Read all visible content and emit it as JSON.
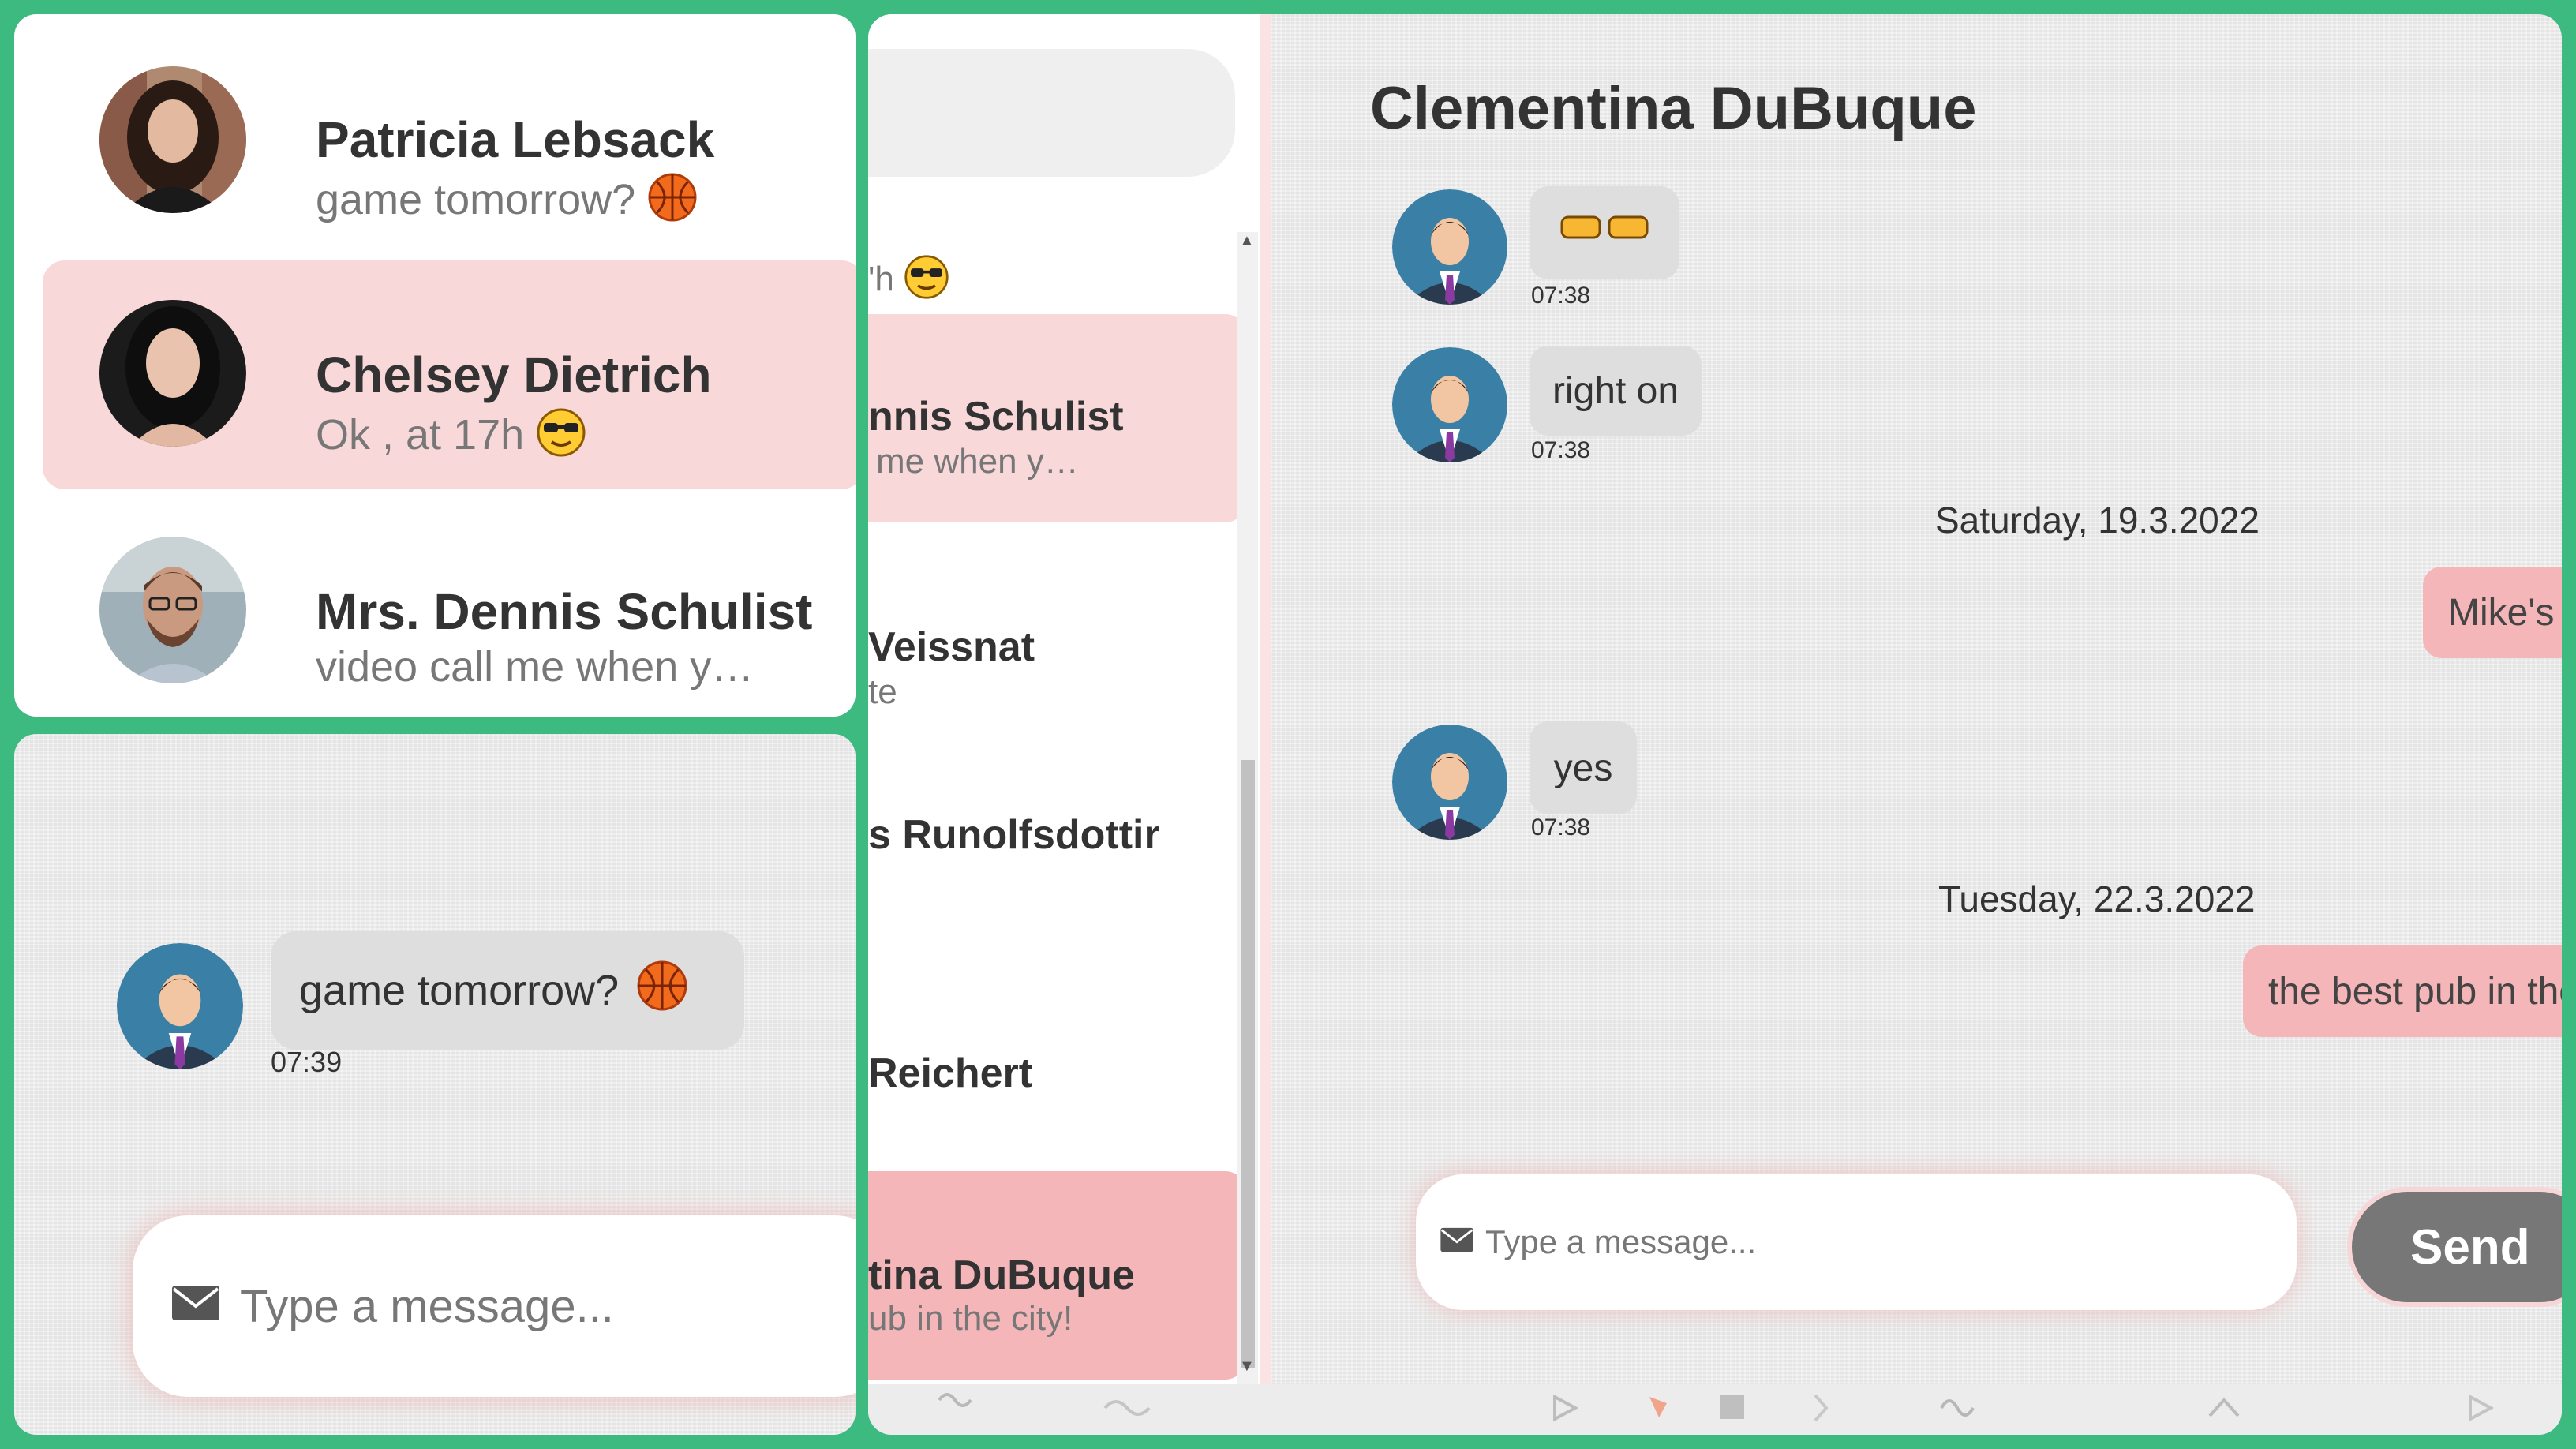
{
  "contacts_closeup": [
    {
      "name": "Patricia Lebsack",
      "preview": "game tomorrow?",
      "emoji": "basketball-icon",
      "selected": false
    },
    {
      "name": "Chelsey Dietrich",
      "preview": "Ok , at 17h",
      "emoji": "sunglasses-face-icon",
      "selected": true
    },
    {
      "name": "Mrs. Dennis Schulist",
      "preview": "video call me when y…",
      "emoji": "",
      "selected": false
    }
  ],
  "chat_closeup": {
    "message": "game tomorrow?",
    "time": "07:39",
    "input_placeholder": "Type a message..."
  },
  "sidebar": {
    "items": [
      {
        "name": "",
        "preview": "'h",
        "state": "normal"
      },
      {
        "name": "nnis Schulist",
        "preview": "me when y…",
        "state": "selected"
      },
      {
        "name": "Veissnat",
        "preview": "te",
        "state": "normal"
      },
      {
        "name": "s Runolfsdottir",
        "preview": "",
        "state": "normal"
      },
      {
        "name": "Reichert",
        "preview": "",
        "state": "normal"
      },
      {
        "name": "tina DuBuque",
        "preview": "ub in the city!",
        "state": "active"
      }
    ]
  },
  "conversation": {
    "title": "Clementina DuBuque",
    "messages": [
      {
        "type": "incoming",
        "text": "",
        "emoji": "fist-bump-icon",
        "time": "07:38"
      },
      {
        "type": "incoming",
        "text": "right on",
        "time": "07:38"
      },
      {
        "type": "date",
        "text": "Saturday, 19.3.2022"
      },
      {
        "type": "outgoing",
        "text": "Mike's"
      },
      {
        "type": "incoming",
        "text": "yes",
        "time": "07:38"
      },
      {
        "type": "date",
        "text": "Tuesday, 22.3.2022"
      },
      {
        "type": "outgoing",
        "text": "the best pub in the"
      }
    ],
    "input_placeholder": "Type a message...",
    "send_label": "Send"
  },
  "colors": {
    "frame": "#3dba7f",
    "selected": "#f9d8da",
    "active": "#f4b6b8",
    "incoming_bubble": "#dedede",
    "outgoing_bubble": "#f4b6b8",
    "send_button": "#777777"
  }
}
